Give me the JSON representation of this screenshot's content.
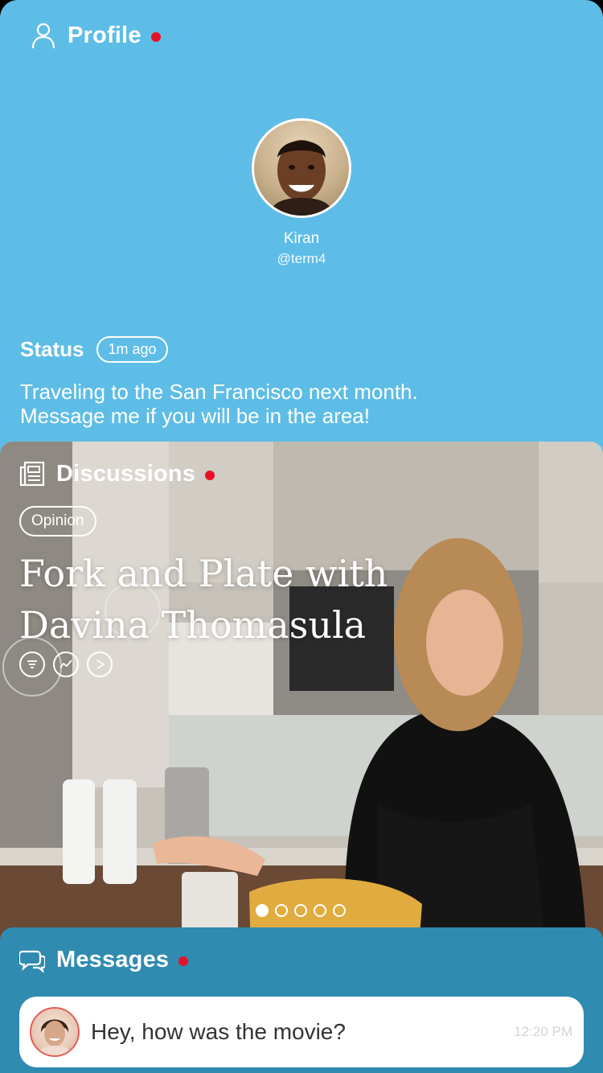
{
  "profile": {
    "title": "Profile",
    "name": "Kiran",
    "handle": "@term4",
    "status_label": "Status",
    "status_time": "1m ago",
    "status_line1": "Traveling to the San Francisco next month.",
    "status_line2": "Message me if you will be in the area!"
  },
  "discussions": {
    "title": "Discussions",
    "tag": "Opinion",
    "headline_line1": "Fork and Plate with",
    "headline_line2": "Davina Thomasula",
    "pages": 5,
    "active_page": 1
  },
  "messages": {
    "title": "Messages",
    "preview_text": "Hey, how was the movie?",
    "preview_time": "12:20 PM"
  },
  "colors": {
    "profile_bg": "#5ebde6",
    "messages_bg": "#2f8bb0",
    "notification_dot": "#e8102b"
  },
  "icons": {
    "profile": "person-icon",
    "discussions": "newspaper-icon",
    "messages": "chat-bubbles-icon",
    "actions": [
      "list-icon",
      "chart-icon",
      "play-icon"
    ]
  }
}
